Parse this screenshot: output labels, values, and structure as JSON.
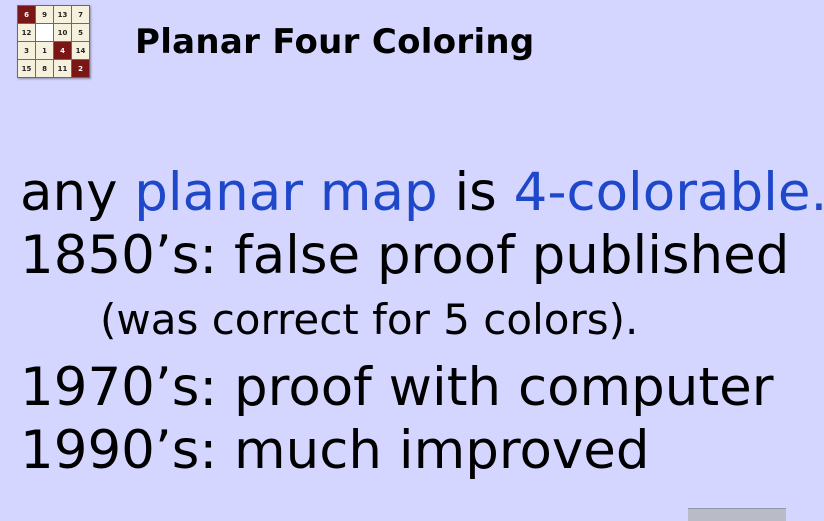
{
  "logo": {
    "cells": [
      "6",
      "9",
      "13",
      "7",
      "12",
      "",
      "10",
      "5",
      "3",
      "1",
      "4",
      "14",
      "15",
      "8",
      "11",
      "2"
    ],
    "dark": [
      0,
      10,
      15
    ]
  },
  "title": "Planar Four Coloring",
  "lines": [
    {
      "parts": [
        "any ",
        "planar map",
        " is ",
        "4-colorable."
      ]
    },
    {
      "text": "1850’s: false proof published"
    },
    {
      "text": "(was correct for 5 colors)."
    },
    {
      "text": "1970’s: proof with computer"
    },
    {
      "text": "1990’s: much improved"
    }
  ],
  "colors": {
    "background": "#d4d6ff",
    "highlight": "#1f47c9",
    "logo_dark": "#7b1616"
  }
}
